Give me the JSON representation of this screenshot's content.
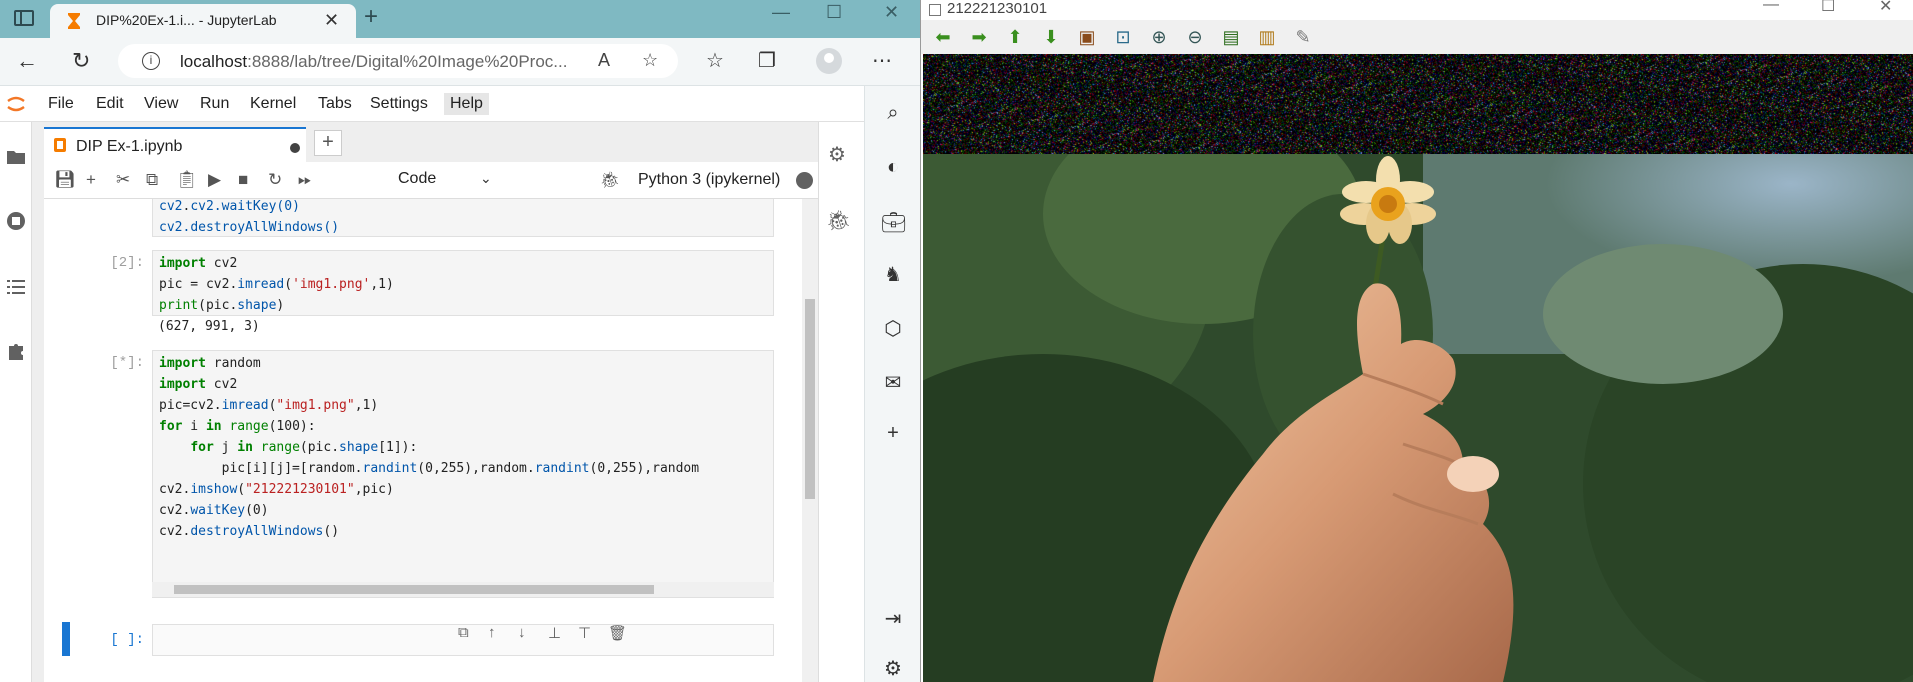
{
  "browser": {
    "tab_title": "DIP%20Ex-1.i... - JupyterLab",
    "url_host": "localhost",
    "url_rest": ":8888/lab/tree/Digital%20Image%20Proc..."
  },
  "jupyter": {
    "menu": [
      "File",
      "Edit",
      "View",
      "Run",
      "Kernel",
      "Tabs",
      "Settings",
      "Help"
    ],
    "doc_tab": "DIP Ex-1.ipynb",
    "cell_type": "Code",
    "kernel": "Python 3 (ipykernel)"
  },
  "cells": {
    "c0": {
      "lines": [
        "cv2.waitKey(0)",
        "cv2.destroyAllWindows()"
      ]
    },
    "c2": {
      "prompt": "[2]:",
      "l1": "import cv2",
      "l2": "pic = cv2.imread('img1.png',1)",
      "l3": "print(pic.shape)",
      "output": "(627, 991, 3)"
    },
    "c3": {
      "prompt": "[*]:",
      "l1": "import random",
      "l2": "import cv2",
      "l3": "pic=cv2.imread(\"img1.png\",1)",
      "l4": "for i in range(100):",
      "l5": "    for j in range(pic.shape[1]):",
      "l6": "        pic[i][j]=[random.randint(0,255),random.randint(0,255),random",
      "l7": "cv2.imshow(\"212221230101\",pic)",
      "l8": "cv2.waitKey(0)",
      "l9": "cv2.destroyAllWindows()"
    },
    "c4": {
      "prompt": "[ ]:"
    }
  },
  "cv_window": {
    "title": "212221230101"
  },
  "colors": {
    "accent": "#1976d2",
    "tabstrip": "#7fb9c2",
    "cv_arrow": "#3a8f1e"
  }
}
